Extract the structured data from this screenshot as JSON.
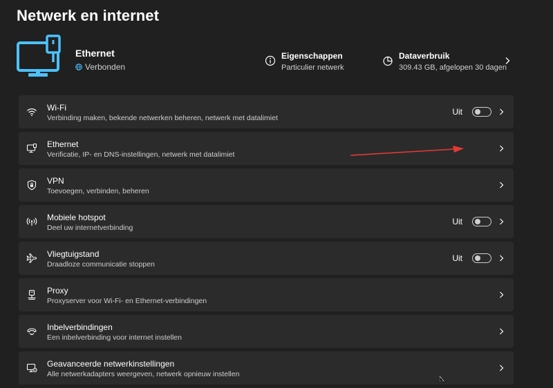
{
  "page": {
    "title": "Netwerk en internet"
  },
  "hero": {
    "icon": "ethernet-monitor-icon",
    "name": "Ethernet",
    "status": "Verbonden",
    "status_icon": "globe-icon",
    "properties": {
      "title": "Eigenschappen",
      "subtitle": "Particulier netwerk",
      "icon": "info-icon"
    },
    "data_usage": {
      "title": "Dataverbruik",
      "subtitle": "309.43 GB, afgelopen 30 dagen",
      "icon": "data-usage-icon"
    }
  },
  "rows": [
    {
      "id": "wifi",
      "icon": "wifi-icon",
      "title": "Wi-Fi",
      "subtitle": "Verbinding maken, bekende netwerken beheren, netwerk met datalimiet",
      "state": "Uit",
      "toggle_on": false
    },
    {
      "id": "ethernet",
      "icon": "ethernet-icon",
      "title": "Ethernet",
      "subtitle": "Verificatie, IP- en DNS-instellingen, netwerk met datalimiet"
    },
    {
      "id": "vpn",
      "icon": "shield-icon",
      "title": "VPN",
      "subtitle": "Toevoegen, verbinden, beheren"
    },
    {
      "id": "hotspot",
      "icon": "hotspot-icon",
      "title": "Mobiele hotspot",
      "subtitle": "Deel uw internetverbinding",
      "state": "Uit",
      "toggle_on": false
    },
    {
      "id": "airplane",
      "icon": "airplane-icon",
      "title": "Vliegtuigstand",
      "subtitle": "Draadloze communicatie stoppen",
      "state": "Uit",
      "toggle_on": false
    },
    {
      "id": "proxy",
      "icon": "proxy-icon",
      "title": "Proxy",
      "subtitle": "Proxyserver voor Wi-Fi- en Ethernet-verbindingen"
    },
    {
      "id": "dialup",
      "icon": "dialup-icon",
      "title": "Inbelverbindingen",
      "subtitle": "Een inbelverbinding voor internet instellen"
    },
    {
      "id": "advanced",
      "icon": "network-settings-icon",
      "title": "Geavanceerde netwerkinstellingen",
      "subtitle": "Alle netwerkadapters weergeven, netwerk opnieuw instellen"
    }
  ],
  "colors": {
    "background": "#202020",
    "card": "#2b2b2b",
    "accent": "#4cc2ff",
    "annotation": "#e53935"
  }
}
